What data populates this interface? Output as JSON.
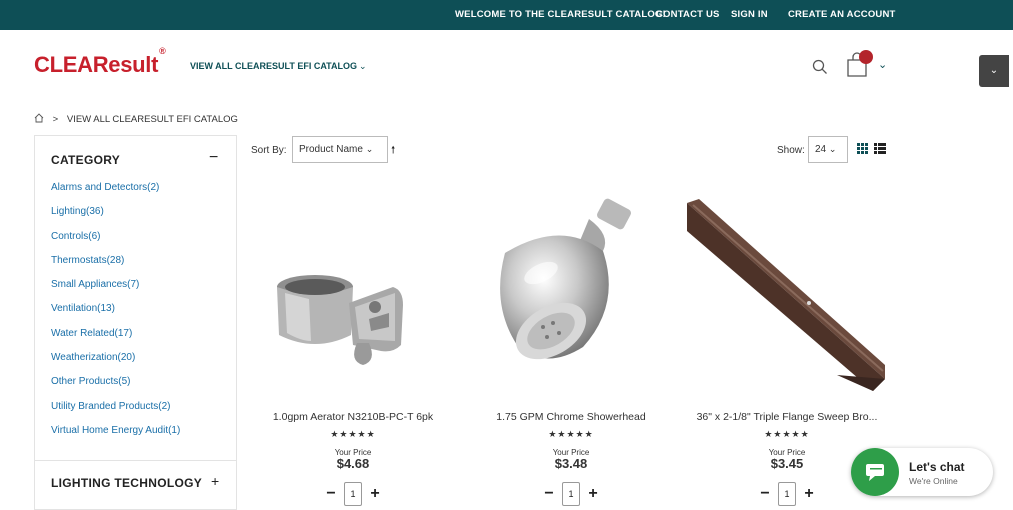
{
  "topbar": {
    "welcome": "WELCOME TO THE CLEARESULT CATALOG!",
    "contact": "CONTACT US",
    "signin": "SIGN IN",
    "create": "CREATE AN ACCOUNT",
    "bg_color": "#0e4f56"
  },
  "header": {
    "logo": "CLEAResult",
    "logo_mark": "®",
    "view_all": "VIEW ALL CLEARESULT EFI CATALOG",
    "view_all_chevron": "chevron-down-icon",
    "brand_color": "#c7202c"
  },
  "breadcrumb": {
    "home_icon": "home-icon",
    "separator": ">",
    "current": "VIEW ALL CLEARESULT EFI CATALOG"
  },
  "sidebar": {
    "category_title": "CATEGORY",
    "category_toggle": "−",
    "categories": [
      {
        "label": "Alarms and Detectors(2)"
      },
      {
        "label": "Lighting(36)"
      },
      {
        "label": "Controls(6)"
      },
      {
        "label": "Thermostats(28)"
      },
      {
        "label": "Small Appliances(7)"
      },
      {
        "label": "Ventilation(13)"
      },
      {
        "label": "Water Related(17)"
      },
      {
        "label": "Weatherization(20)"
      },
      {
        "label": "Other Products(5)"
      },
      {
        "label": "Utility Branded Products(2)"
      },
      {
        "label": "Virtual Home Energy Audit(1)"
      }
    ],
    "tech_title": "LIGHTING TECHNOLOGY",
    "tech_toggle": "+"
  },
  "toolbar": {
    "sort_label": "Sort By:",
    "sort_value": "Product Name",
    "show_label": "Show:",
    "show_value": "24"
  },
  "products": [
    {
      "name": "1.0gpm Aerator N3210B-PC-T 6pk",
      "stars": "★★★★★",
      "price_label": "Your Price",
      "price": "$4.68",
      "qty": "1"
    },
    {
      "name": "1.75 GPM Chrome Showerhead",
      "stars": "★★★★★",
      "price_label": "Your Price",
      "price": "$3.48",
      "qty": "1"
    },
    {
      "name": "36\" x 2-1/8\" Triple Flange Sweep Bro...",
      "stars": "★★★★★",
      "price_label": "Your Price",
      "price": "$3.45",
      "qty": "1"
    }
  ],
  "chat": {
    "title": "Let's chat",
    "subtitle": "We're Online",
    "color": "#2e9e49"
  }
}
